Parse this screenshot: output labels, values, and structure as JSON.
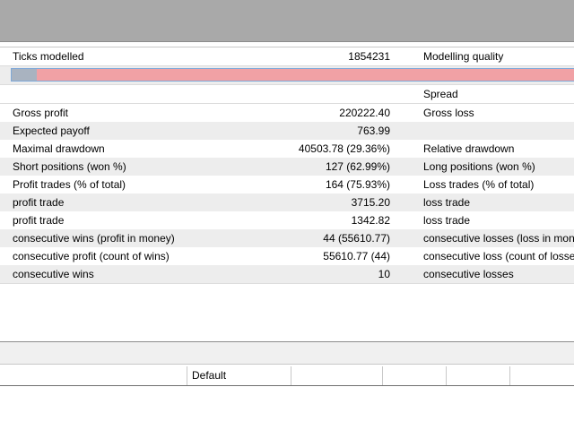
{
  "stats": {
    "ticks_label": "Ticks modelled",
    "ticks_value": "1854231",
    "quality_label": "Modelling quality",
    "quality_fraction": 0.045,
    "spread_label": "Spread",
    "rows": [
      {
        "label": "Gross profit",
        "value": "220222.40",
        "label2": "Gross loss"
      },
      {
        "label": "Expected payoff",
        "value": "763.99",
        "label2": ""
      },
      {
        "label": "Maximal drawdown",
        "value": "40503.78 (29.36%)",
        "label2": "Relative drawdown"
      },
      {
        "label": "Short positions (won %)",
        "value": "127 (62.99%)",
        "label2": "Long positions (won %)"
      },
      {
        "label": "Profit trades (% of total)",
        "value": "164 (75.93%)",
        "label2": "Loss trades (% of total)"
      },
      {
        "label": "profit trade",
        "value": "3715.20",
        "label2": "loss trade"
      },
      {
        "label": "profit trade",
        "value": "1342.82",
        "label2": "loss trade"
      },
      {
        "label": "consecutive wins (profit in money)",
        "value": "44 (55610.77)",
        "label2": "consecutive losses (loss in money)"
      },
      {
        "label": "consecutive profit (count of wins)",
        "value": "55610.77 (44)",
        "label2": "consecutive loss (count of losses)"
      },
      {
        "label": "consecutive wins",
        "value": "10",
        "label2": "consecutive losses"
      }
    ]
  },
  "lower_grid": {
    "cell_text": "Default"
  }
}
